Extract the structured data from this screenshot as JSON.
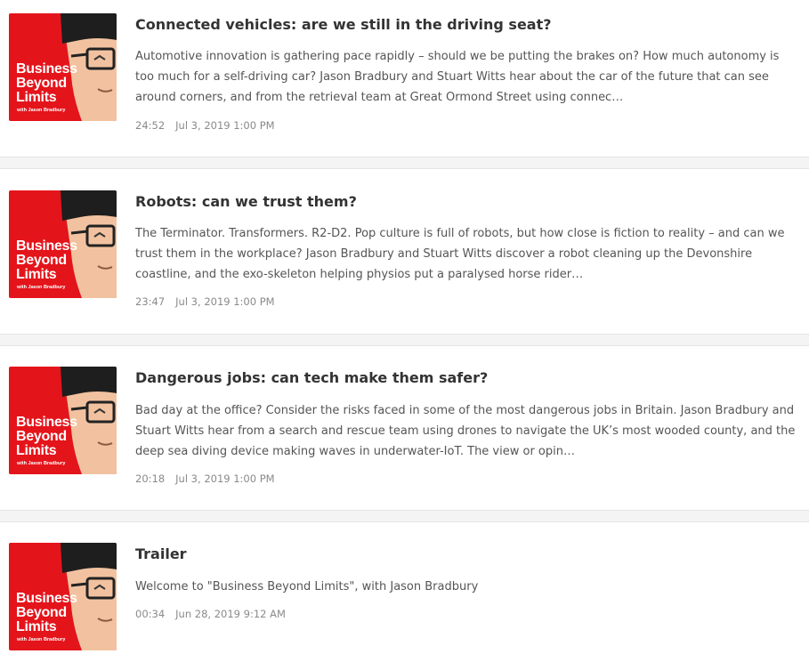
{
  "podcast": {
    "cover_line1": "Business",
    "cover_line2": "Beyond",
    "cover_line3": "Limits",
    "cover_byline": "with Jason Bradbury"
  },
  "episodes": [
    {
      "title": "Connected vehicles: are we still in the driving seat?",
      "description": "Automotive innovation is gathering pace rapidly – should we be putting the brakes on? How much autonomy is too much for a self-driving car? Jason Bradbury and Stuart Witts hear about the car of the future that can see around corners, and from the retrieval team at Great Ormond Street using connec…",
      "duration": "24:52",
      "date": "Jul 3, 2019 1:00 PM"
    },
    {
      "title": "Robots: can we trust them?",
      "description": "The Terminator. Transformers. R2-D2. Pop culture is full of robots, but how close is fiction to reality – and can we trust them in the workplace? Jason Bradbury and Stuart Witts discover a robot cleaning up the Devonshire coastline, and the exo-skeleton helping physios put a paralysed horse rider…",
      "duration": "23:47",
      "date": "Jul 3, 2019 1:00 PM"
    },
    {
      "title": "Dangerous jobs: can tech make them safer?",
      "description": "Bad day at the office? Consider the risks faced in some of the most dangerous jobs in Britain. Jason Bradbury and Stuart Witts hear from a search and rescue team using drones to navigate the UK’s most wooded county, and the deep sea diving device making waves in underwater-IoT.  The view or opin…",
      "duration": "20:18",
      "date": "Jul 3, 2019 1:00 PM"
    },
    {
      "title": "Trailer",
      "description": "Welcome to \"Business Beyond Limits\", with Jason Bradbury",
      "duration": "00:34",
      "date": "Jun 28, 2019 9:12 AM"
    }
  ],
  "colors": {
    "cover_red": "#e4141b",
    "separator": "#f4f4f4",
    "title_text": "#333333",
    "meta_text": "#8a8a8a"
  }
}
